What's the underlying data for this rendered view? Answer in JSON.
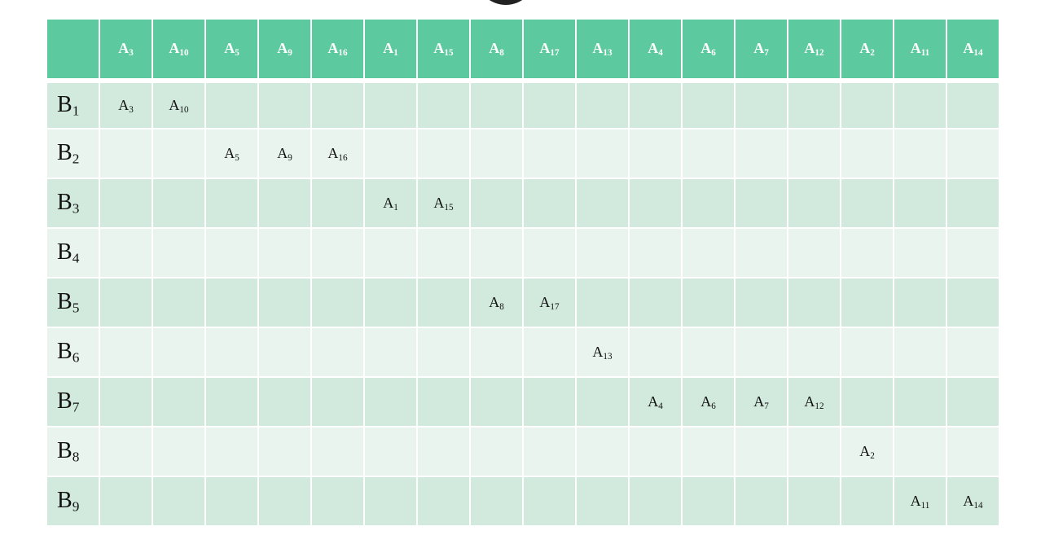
{
  "columns": [
    {
      "base": "A",
      "sub": "3"
    },
    {
      "base": "A",
      "sub": "10"
    },
    {
      "base": "A",
      "sub": "5"
    },
    {
      "base": "A",
      "sub": "9"
    },
    {
      "base": "A",
      "sub": "16"
    },
    {
      "base": "A",
      "sub": "1"
    },
    {
      "base": "A",
      "sub": "15"
    },
    {
      "base": "A",
      "sub": "8"
    },
    {
      "base": "A",
      "sub": "17"
    },
    {
      "base": "A",
      "sub": "13"
    },
    {
      "base": "A",
      "sub": "4"
    },
    {
      "base": "A",
      "sub": "6"
    },
    {
      "base": "A",
      "sub": "7"
    },
    {
      "base": "A",
      "sub": "12"
    },
    {
      "base": "A",
      "sub": "2"
    },
    {
      "base": "A",
      "sub": "11"
    },
    {
      "base": "A",
      "sub": "14"
    }
  ],
  "rows": [
    {
      "base": "B",
      "sub": "1",
      "cells": [
        "A3",
        "A10",
        "",
        "",
        "",
        "",
        "",
        "",
        "",
        "",
        "",
        "",
        "",
        "",
        "",
        "",
        ""
      ]
    },
    {
      "base": "B",
      "sub": "2",
      "cells": [
        "",
        "",
        "A5",
        "A9",
        "A16",
        "",
        "",
        "",
        "",
        "",
        "",
        "",
        "",
        "",
        "",
        "",
        ""
      ]
    },
    {
      "base": "B",
      "sub": "3",
      "cells": [
        "",
        "",
        "",
        "",
        "",
        "A1",
        "A15",
        "",
        "",
        "",
        "",
        "",
        "",
        "",
        "",
        "",
        ""
      ]
    },
    {
      "base": "B",
      "sub": "4",
      "cells": [
        "",
        "",
        "",
        "",
        "",
        "",
        "",
        "",
        "",
        "",
        "",
        "",
        "",
        "",
        "",
        "",
        ""
      ]
    },
    {
      "base": "B",
      "sub": "5",
      "cells": [
        "",
        "",
        "",
        "",
        "",
        "",
        "",
        "A8",
        "A17",
        "",
        "",
        "",
        "",
        "",
        "",
        "",
        ""
      ]
    },
    {
      "base": "B",
      "sub": "6",
      "cells": [
        "",
        "",
        "",
        "",
        "",
        "",
        "",
        "",
        "",
        "A13",
        "",
        "",
        "",
        "",
        "",
        "",
        ""
      ]
    },
    {
      "base": "B",
      "sub": "7",
      "cells": [
        "",
        "",
        "",
        "",
        "",
        "",
        "",
        "",
        "",
        "",
        "A4",
        "A6",
        "A7",
        "A12",
        "",
        "",
        ""
      ]
    },
    {
      "base": "B",
      "sub": "8",
      "cells": [
        "",
        "",
        "",
        "",
        "",
        "",
        "",
        "",
        "",
        "",
        "",
        "",
        "",
        "",
        "A2",
        "",
        ""
      ]
    },
    {
      "base": "B",
      "sub": "9",
      "cells": [
        "",
        "",
        "",
        "",
        "",
        "",
        "",
        "",
        "",
        "",
        "",
        "",
        "",
        "",
        "",
        "A11",
        "A14"
      ]
    }
  ],
  "colors": {
    "header_bg": "#5dc99e",
    "row_odd_bg": "#d1eadd",
    "row_even_bg": "#e9f4ee"
  }
}
